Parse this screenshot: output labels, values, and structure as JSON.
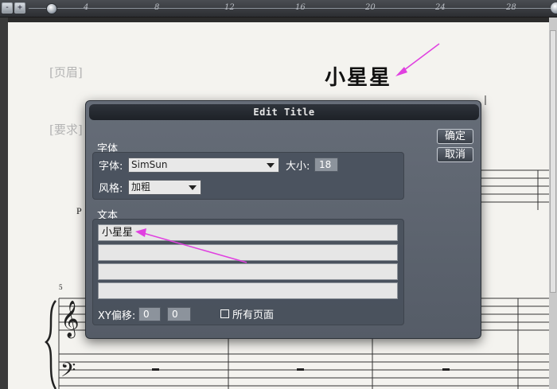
{
  "ruler": {
    "ticks": [
      "4",
      "8",
      "12",
      "16",
      "20",
      "24",
      "28"
    ],
    "left_buttons": [
      "-",
      "+"
    ]
  },
  "score": {
    "header_label": "[页眉]",
    "requirement_label": "[要求]",
    "title": "小星星",
    "dynamic_mark": "P",
    "measure_number": "5",
    "annotation_color": "#e040e0"
  },
  "dialog": {
    "title": "Edit Title",
    "ok_label": "确定",
    "cancel_label": "取消",
    "font_group": {
      "label": "字体",
      "font_label": "字体:",
      "font_value": "SimSun",
      "size_label": "大小:",
      "size_value": "18",
      "style_label": "风格:",
      "style_value": "加粗"
    },
    "text_group": {
      "label": "文本",
      "lines": [
        "小星星",
        "",
        "",
        ""
      ]
    },
    "offset": {
      "label": "XY偏移:",
      "x": "0",
      "y": "0"
    },
    "all_pages": {
      "label": "所有页面",
      "checked": false
    }
  }
}
